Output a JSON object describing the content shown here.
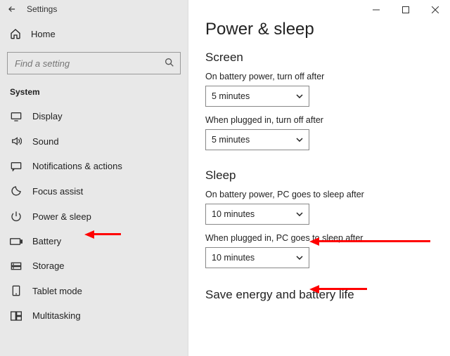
{
  "titlebar": {
    "text": "Settings"
  },
  "home": {
    "label": "Home"
  },
  "search": {
    "placeholder": "Find a setting"
  },
  "section_label": "System",
  "nav": [
    {
      "icon": "display",
      "label": "Display"
    },
    {
      "icon": "sound",
      "label": "Sound"
    },
    {
      "icon": "notifications",
      "label": "Notifications & actions"
    },
    {
      "icon": "focus",
      "label": "Focus assist"
    },
    {
      "icon": "power",
      "label": "Power & sleep"
    },
    {
      "icon": "battery",
      "label": "Battery"
    },
    {
      "icon": "storage",
      "label": "Storage"
    },
    {
      "icon": "tablet",
      "label": "Tablet mode"
    },
    {
      "icon": "multitask",
      "label": "Multitasking"
    }
  ],
  "main": {
    "title": "Power & sleep",
    "screen": {
      "heading": "Screen",
      "battery_label": "On battery power, turn off after",
      "battery_value": "5 minutes",
      "plugged_label": "When plugged in, turn off after",
      "plugged_value": "5 minutes"
    },
    "sleep": {
      "heading": "Sleep",
      "battery_label": "On battery power, PC goes to sleep after",
      "battery_value": "10 minutes",
      "plugged_label": "When plugged in, PC goes to sleep after",
      "plugged_value": "10 minutes"
    },
    "save_heading": "Save energy and battery life"
  }
}
